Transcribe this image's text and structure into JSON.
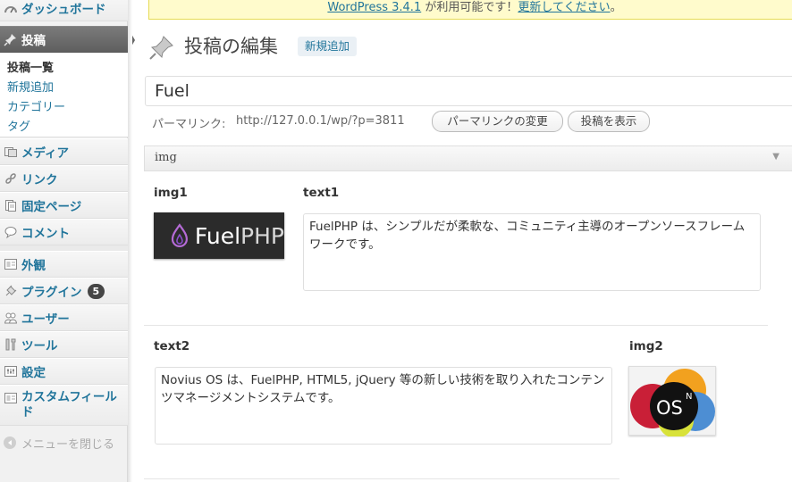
{
  "sidebar": {
    "dashboard": "ダッシュボード",
    "posts": "投稿",
    "submenu": [
      "投稿一覧",
      "新規追加",
      "カテゴリー",
      "タグ"
    ],
    "media": "メディア",
    "links": "リンク",
    "pages": "固定ページ",
    "comments": "コメント",
    "appearance": "外観",
    "plugins": "プラグイン",
    "plugins_badge": "5",
    "users": "ユーザー",
    "tools": "ツール",
    "settings": "設定",
    "custom_fields": "カスタムフィールド",
    "collapse": "メニューを閉じる"
  },
  "nag": {
    "link1": "WordPress 3.4.1",
    "text": " が利用可能です！",
    "link2": "更新してください",
    "end": "。"
  },
  "heading": {
    "title": "投稿の編集",
    "add_new": "新規追加"
  },
  "post": {
    "title": "Fuel",
    "permalink_label": "パーマリンク:",
    "permalink_url": "http://127.0.0.1/wp/?p=3811",
    "change_permalink": "パーマリンクの変更",
    "view_post": "投稿を表示"
  },
  "metabox": {
    "title": "img",
    "img1_label": "img1",
    "text1_label": "text1",
    "text1_value": "FuelPHP は、シンプルだが柔軟な、コミュニティ主導のオープンソースフレームワークです。",
    "text2_label": "text2",
    "text2_value": "Novius OS は、FuelPHP, HTML5, jQuery 等の新しい技術を取り入れたコンテンツマネージメントシステムです。",
    "img2_label": "img2",
    "fuel_logo_a": "Fuel",
    "fuel_logo_b": "PHP",
    "novius_logo": "OS",
    "novius_sup": "N"
  },
  "colors": {
    "link": "#21759b",
    "current_menu": "#6d6d6d",
    "nag_bg": "#fffbcc"
  }
}
